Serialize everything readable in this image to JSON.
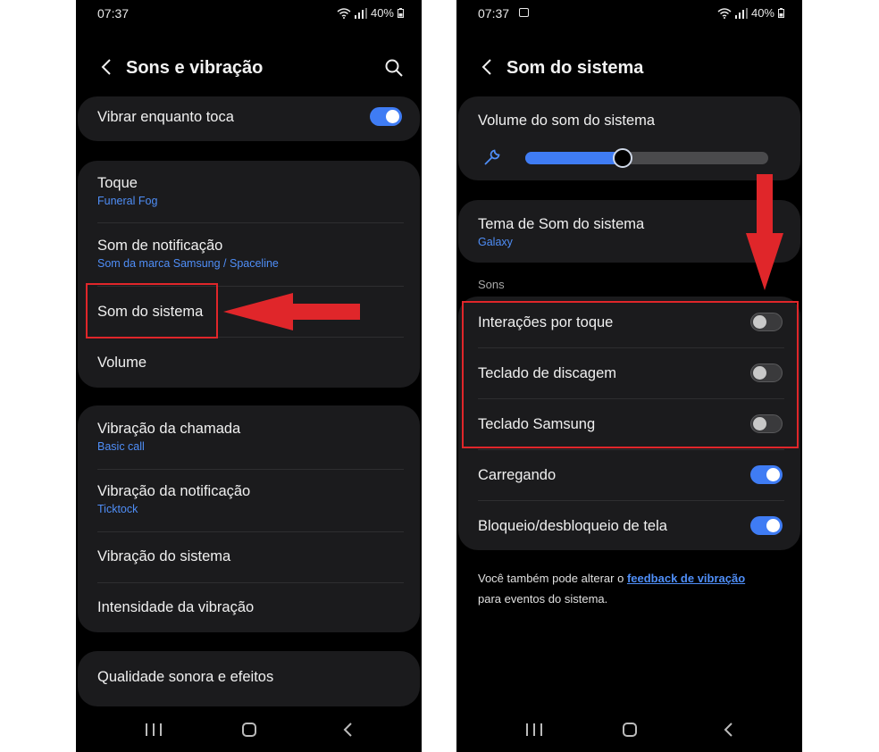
{
  "left": {
    "status": {
      "time": "07:37",
      "battery": "40%"
    },
    "header": {
      "title": "Sons e vibração"
    },
    "vibrate_while_ringing": {
      "label": "Vibrar enquanto toca",
      "enabled": true
    },
    "sound_items": [
      {
        "label": "Toque",
        "sub": "Funeral Fog"
      },
      {
        "label": "Som de notificação",
        "sub": "Som da marca Samsung / Spaceline"
      },
      {
        "label": "Som do sistema",
        "sub": ""
      },
      {
        "label": "Volume",
        "sub": ""
      }
    ],
    "vibration_items": [
      {
        "label": "Vibração da chamada",
        "sub": "Basic call"
      },
      {
        "label": "Vibração da notificação",
        "sub": "Ticktock"
      },
      {
        "label": "Vibração do sistema",
        "sub": ""
      },
      {
        "label": "Intensidade da vibração",
        "sub": ""
      }
    ],
    "quality": {
      "label": "Qualidade sonora e efeitos"
    }
  },
  "right": {
    "status": {
      "time": "07:37",
      "battery": "40%"
    },
    "header": {
      "title": "Som do sistema"
    },
    "volume": {
      "label": "Volume do som do sistema",
      "level_fraction": 0.4
    },
    "theme": {
      "label": "Tema de Som do sistema",
      "sub": "Galaxy"
    },
    "section_label": "Sons",
    "toggles": [
      {
        "label": "Interações por toque",
        "enabled": false
      },
      {
        "label": "Teclado de discagem",
        "enabled": false
      },
      {
        "label": "Teclado Samsung",
        "enabled": false
      },
      {
        "label": "Carregando",
        "enabled": true
      },
      {
        "label": "Bloqueio/desbloqueio de tela",
        "enabled": true
      }
    ],
    "note": {
      "prefix": "Você também pode alterar o ",
      "link": "feedback de vibração",
      "suffix": "para eventos do sistema."
    }
  },
  "colors": {
    "accent": "#3f7cf4",
    "highlight": "#e0262a",
    "sub_text": "#4f8ef7",
    "card": "#1b1b1d"
  },
  "icons": {
    "back": "chevron-left-icon",
    "search": "search-icon",
    "volume": "wrench-icon"
  }
}
